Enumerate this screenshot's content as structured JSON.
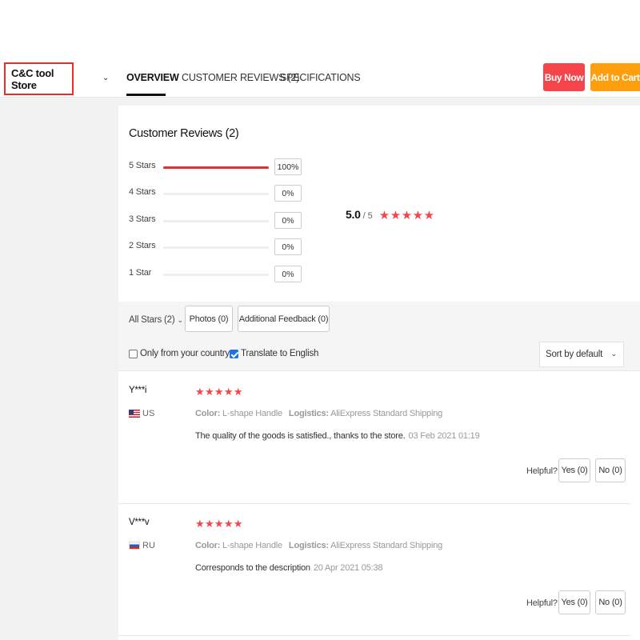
{
  "header": {
    "store_name": "C&C tool Store",
    "tabs": [
      {
        "label": "OVERVIEW",
        "active": true
      },
      {
        "label": "CUSTOMER REVIEWS (2)",
        "active": false
      },
      {
        "label": "SPECIFICATIONS",
        "active": false
      }
    ],
    "buy_now_label": "Buy Now",
    "add_to_cart_label": "Add to Cart",
    "colors": {
      "buy_now": "#f5454a",
      "add_to_cart": "#ff9e0d",
      "accent": "#e62e2e"
    }
  },
  "reviews_summary": {
    "title": "Customer Reviews (2)",
    "breakdown": [
      {
        "label": "5 Stars",
        "percent_text": "100%",
        "fraction": 1.0
      },
      {
        "label": "4 Stars",
        "percent_text": "0%",
        "fraction": 0
      },
      {
        "label": "3 Stars",
        "percent_text": "0%",
        "fraction": 0
      },
      {
        "label": "2 Stars",
        "percent_text": "0%",
        "fraction": 0
      },
      {
        "label": "1 Star",
        "percent_text": "0%",
        "fraction": 0
      }
    ],
    "average": "5.0",
    "out_of": "/ 5",
    "stars": "★★★★★"
  },
  "filters": {
    "all_stars": "All Stars (2)",
    "photos": "Photos (0)",
    "additional_feedback": "Additional Feedback (0)",
    "only_country": {
      "label": "Only from your country",
      "checked": false
    },
    "translate": {
      "label": "Translate to English",
      "checked": true
    },
    "sort_value": "Sort by default"
  },
  "reviews": [
    {
      "name": "Y***i",
      "country": "US",
      "stars": "★★★★★",
      "color_label": "Color:",
      "color_value": "L-shape Handle",
      "logistics_label": "Logistics:",
      "logistics_value": "AliExpress Standard Shipping",
      "text": "The quality of the goods is satisfied., thanks to the store.",
      "date": "03 Feb 2021 01:19",
      "helpful_label": "Helpful?",
      "yes_label": "Yes (0)",
      "no_label": "No (0)"
    },
    {
      "name": "V***v",
      "country": "RU",
      "stars": "★★★★★",
      "color_label": "Color:",
      "color_value": "L-shape Handle",
      "logistics_label": "Logistics:",
      "logistics_value": "AliExpress Standard Shipping",
      "text": "Corresponds to the description",
      "date": "20 Apr 2021 05:38",
      "helpful_label": "Helpful?",
      "yes_label": "Yes (0)",
      "no_label": "No (0)"
    }
  ]
}
